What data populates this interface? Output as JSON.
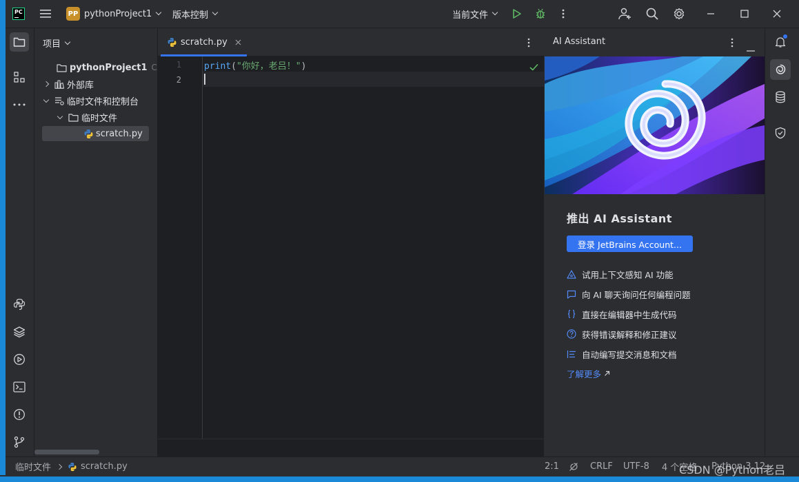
{
  "titlebar": {
    "project_badge": "PP",
    "project_name": "pythonProject1",
    "vcs_menu": "版本控制",
    "run_config": "当前文件"
  },
  "project_panel": {
    "title": "项目",
    "tree": [
      {
        "label": "pythonProject1",
        "suffix": "C:\\U"
      },
      {
        "label": "外部库"
      },
      {
        "label": "临时文件和控制台"
      },
      {
        "label": "临时文件"
      },
      {
        "label": "scratch.py"
      }
    ]
  },
  "editor": {
    "tab_label": "scratch.py",
    "line_numbers": [
      "1",
      "2"
    ],
    "code_fn": "print",
    "code_open": "(",
    "code_string": "\"你好，老吕！\"",
    "code_close": ")"
  },
  "ai_panel": {
    "title": "AI Assistant",
    "heading": "推出 AI Assistant",
    "login_button": "登录 JetBrains Account...",
    "features": [
      "试用上下文感知 AI 功能",
      "向 AI 聊天询问任何编程问题",
      "直接在编辑器中生成代码",
      "获得错误解释和修正建议",
      "自动编写提交消息和文档"
    ],
    "learn_more": "了解更多"
  },
  "statusbar": {
    "breadcrumb_folder": "临时文件",
    "breadcrumb_file": "scratch.py",
    "position": "2:1",
    "line_sep": "CRLF",
    "encoding": "UTF-8",
    "indent": "4 个空格",
    "interpreter": "Python 3.12"
  },
  "watermark": "CSDN @Python老吕",
  "colors": {
    "accent": "#3574f0",
    "string": "#6aab73",
    "function": "#56a8f5",
    "run_green": "#5fb865"
  }
}
